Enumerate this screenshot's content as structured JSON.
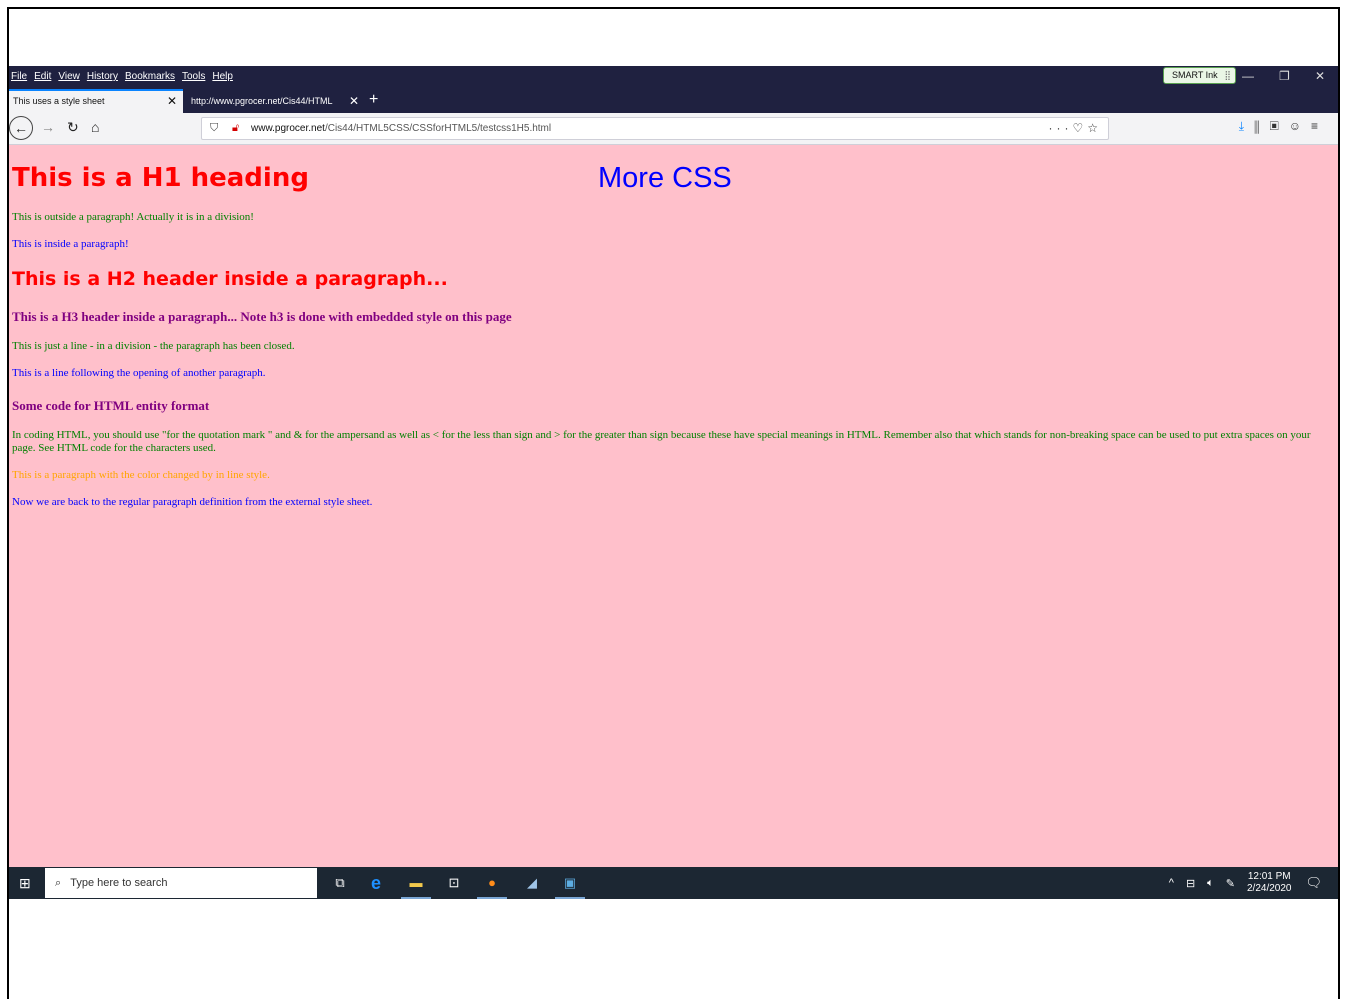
{
  "menubar": {
    "items": [
      "File",
      "Edit",
      "View",
      "History",
      "Bookmarks",
      "Tools",
      "Help"
    ],
    "smart_ink": "SMART Ink"
  },
  "tabs": [
    {
      "label": "This uses a style sheet",
      "active": true
    },
    {
      "label": "http://www.pgrocer.net/Cis44/HTML",
      "active": false
    }
  ],
  "navbar": {
    "url_domain": "www.pgrocer.net",
    "url_path": "/Cis44/HTML5CSS/CSSforHTML5/testcss1H5.html"
  },
  "page": {
    "h1": "This is a H1 heading",
    "more_css": "More CSS",
    "line1": "This is outside a paragraph! Actually it is in a division!",
    "line2": "This is inside a paragraph!",
    "h2": "This is a H2 header inside a paragraph...",
    "h3a": "This is a H3 header inside a paragraph... Note h3 is done with embedded style on this page",
    "line3": "This is just a line - in a division - the paragraph has been closed.",
    "line4": "This is a line following the opening of another paragraph.",
    "h3b": "Some code for HTML entity format",
    "entity_para": "In coding HTML, you should use \"for the quotation mark \" and & for the ampersand as well as < for the less than sign and > for the greater than sign because these have special meanings in HTML. Remember also that   which stands for non-breaking space can be used to put extra spaces on your page. See HTML code for the characters used.",
    "orange_line": "This is a paragraph with the color changed by in line style.",
    "last_line": "Now we are back to the regular paragraph definition from the external style sheet."
  },
  "taskbar": {
    "search_placeholder": "Type here to search",
    "time": "12:01 PM",
    "date": "2/24/2020"
  },
  "colors": {
    "page_background": "#ffc0cb",
    "heading_red": "#ff0000",
    "text_green": "#008000",
    "text_blue": "#0000ff",
    "h3_purple": "#800080",
    "inline_orange": "#ffa500"
  }
}
